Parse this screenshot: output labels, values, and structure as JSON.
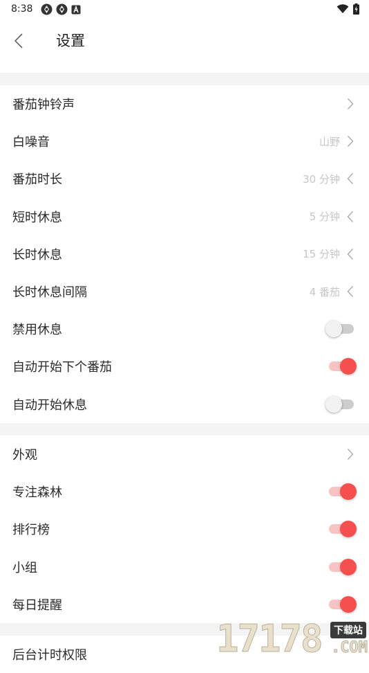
{
  "status_bar": {
    "time": "8:38"
  },
  "header": {
    "title": "设置"
  },
  "section1": {
    "rows": [
      {
        "label": "番茄钟铃声",
        "value": "",
        "control": "chevron-right"
      },
      {
        "label": "白噪音",
        "value": "山野",
        "control": "chevron-right"
      },
      {
        "label": "番茄时长",
        "value": "30 分钟",
        "control": "chevron-left"
      },
      {
        "label": "短时休息",
        "value": "5 分钟",
        "control": "chevron-left"
      },
      {
        "label": "长时休息",
        "value": "15 分钟",
        "control": "chevron-left"
      },
      {
        "label": "长时休息间隔",
        "value": "4 番茄",
        "control": "chevron-left"
      },
      {
        "label": "禁用休息",
        "control": "toggle",
        "on": false
      },
      {
        "label": "自动开始下个番茄",
        "control": "toggle",
        "on": true
      },
      {
        "label": "自动开始休息",
        "control": "toggle",
        "on": false
      }
    ]
  },
  "section2": {
    "rows": [
      {
        "label": "外观",
        "value": "",
        "control": "chevron-right"
      },
      {
        "label": "专注森林",
        "control": "toggle",
        "on": true
      },
      {
        "label": "排行榜",
        "control": "toggle",
        "on": true
      },
      {
        "label": "小组",
        "control": "toggle",
        "on": true
      },
      {
        "label": "每日提醒",
        "control": "toggle",
        "on": true
      }
    ]
  },
  "section3": {
    "rows": [
      {
        "label": "后台计时权限"
      }
    ]
  },
  "watermark": {
    "digits": "17178",
    "badge": "下载站",
    "suffix": ".COM"
  },
  "colors": {
    "accent": "#f54f4f",
    "accent_track": "#f8c3c3",
    "value_text": "#c6c6c6",
    "divider": "#f4f4f4"
  }
}
